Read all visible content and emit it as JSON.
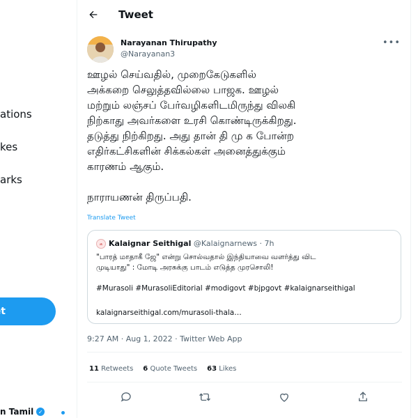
{
  "sidebar": {
    "items": [
      {
        "label": "ations"
      },
      {
        "label": "kes"
      },
      {
        "label": "arks"
      }
    ],
    "tweet_button": "et",
    "account_name": "n Tamil"
  },
  "header": {
    "title": "Tweet"
  },
  "tweet": {
    "author_name": "Narayanan Thirupathy",
    "author_handle": "@Narayanan3",
    "text": "ஊழல் செய்வதில், முறைகேடுகளில்\nஅக்கறை செலுத்தவில்லை பாஜக. ஊழல்\nமற்றும் லஞ்சப் பேர்வழிகளிடமிருந்து விலகி\nநிற்காது அவர்களை உரசி கொண்டிருக்கிறது.\nதடுத்து நிற்கிறது. அது தான் தி மு க போன்ற\nஎதிர்கட்சிகளின் சிக்கல்கள் அனைத்துக்கும்\nகாரணம் ஆகும்.\n\nநாராயணன் திருப்பதி.",
    "translate_label": "Translate Tweet",
    "timestamp": "9:27 AM · Aug 1, 2022 · Twitter Web App"
  },
  "quote": {
    "avatar_text": "க",
    "name": "Kalaignar Seithigal",
    "handle": "@Kalaignarnews",
    "time": "· 7h",
    "text": "\"பாரத் மாதாகீ ஜே\" என்று சொல்வதால் இந்தியாவை வளர்த்து விட\nமுடியாது\" : மோடி அரசுக்கு பாடம் எடுத்த முரசொலி!",
    "hashtags": "#Murasoli #MurasoliEditorial #modigovt #bjpgovt #kalaignarseithigal",
    "link": "kalaignarseithigal.com/murasoli-thala…"
  },
  "stats": {
    "retweets_count": "11",
    "retweets_label": "Retweets",
    "quotes_count": "6",
    "quotes_label": "Quote Tweets",
    "likes_count": "63",
    "likes_label": "Likes"
  },
  "icons": [
    "back-arrow-icon",
    "more-icon",
    "reply-icon",
    "retweet-icon",
    "like-icon",
    "share-icon",
    "verified-icon"
  ],
  "colors": {
    "accent": "#1d9bf0",
    "text": "#0f1419",
    "muted": "#536471",
    "border": "#cfd9de"
  }
}
